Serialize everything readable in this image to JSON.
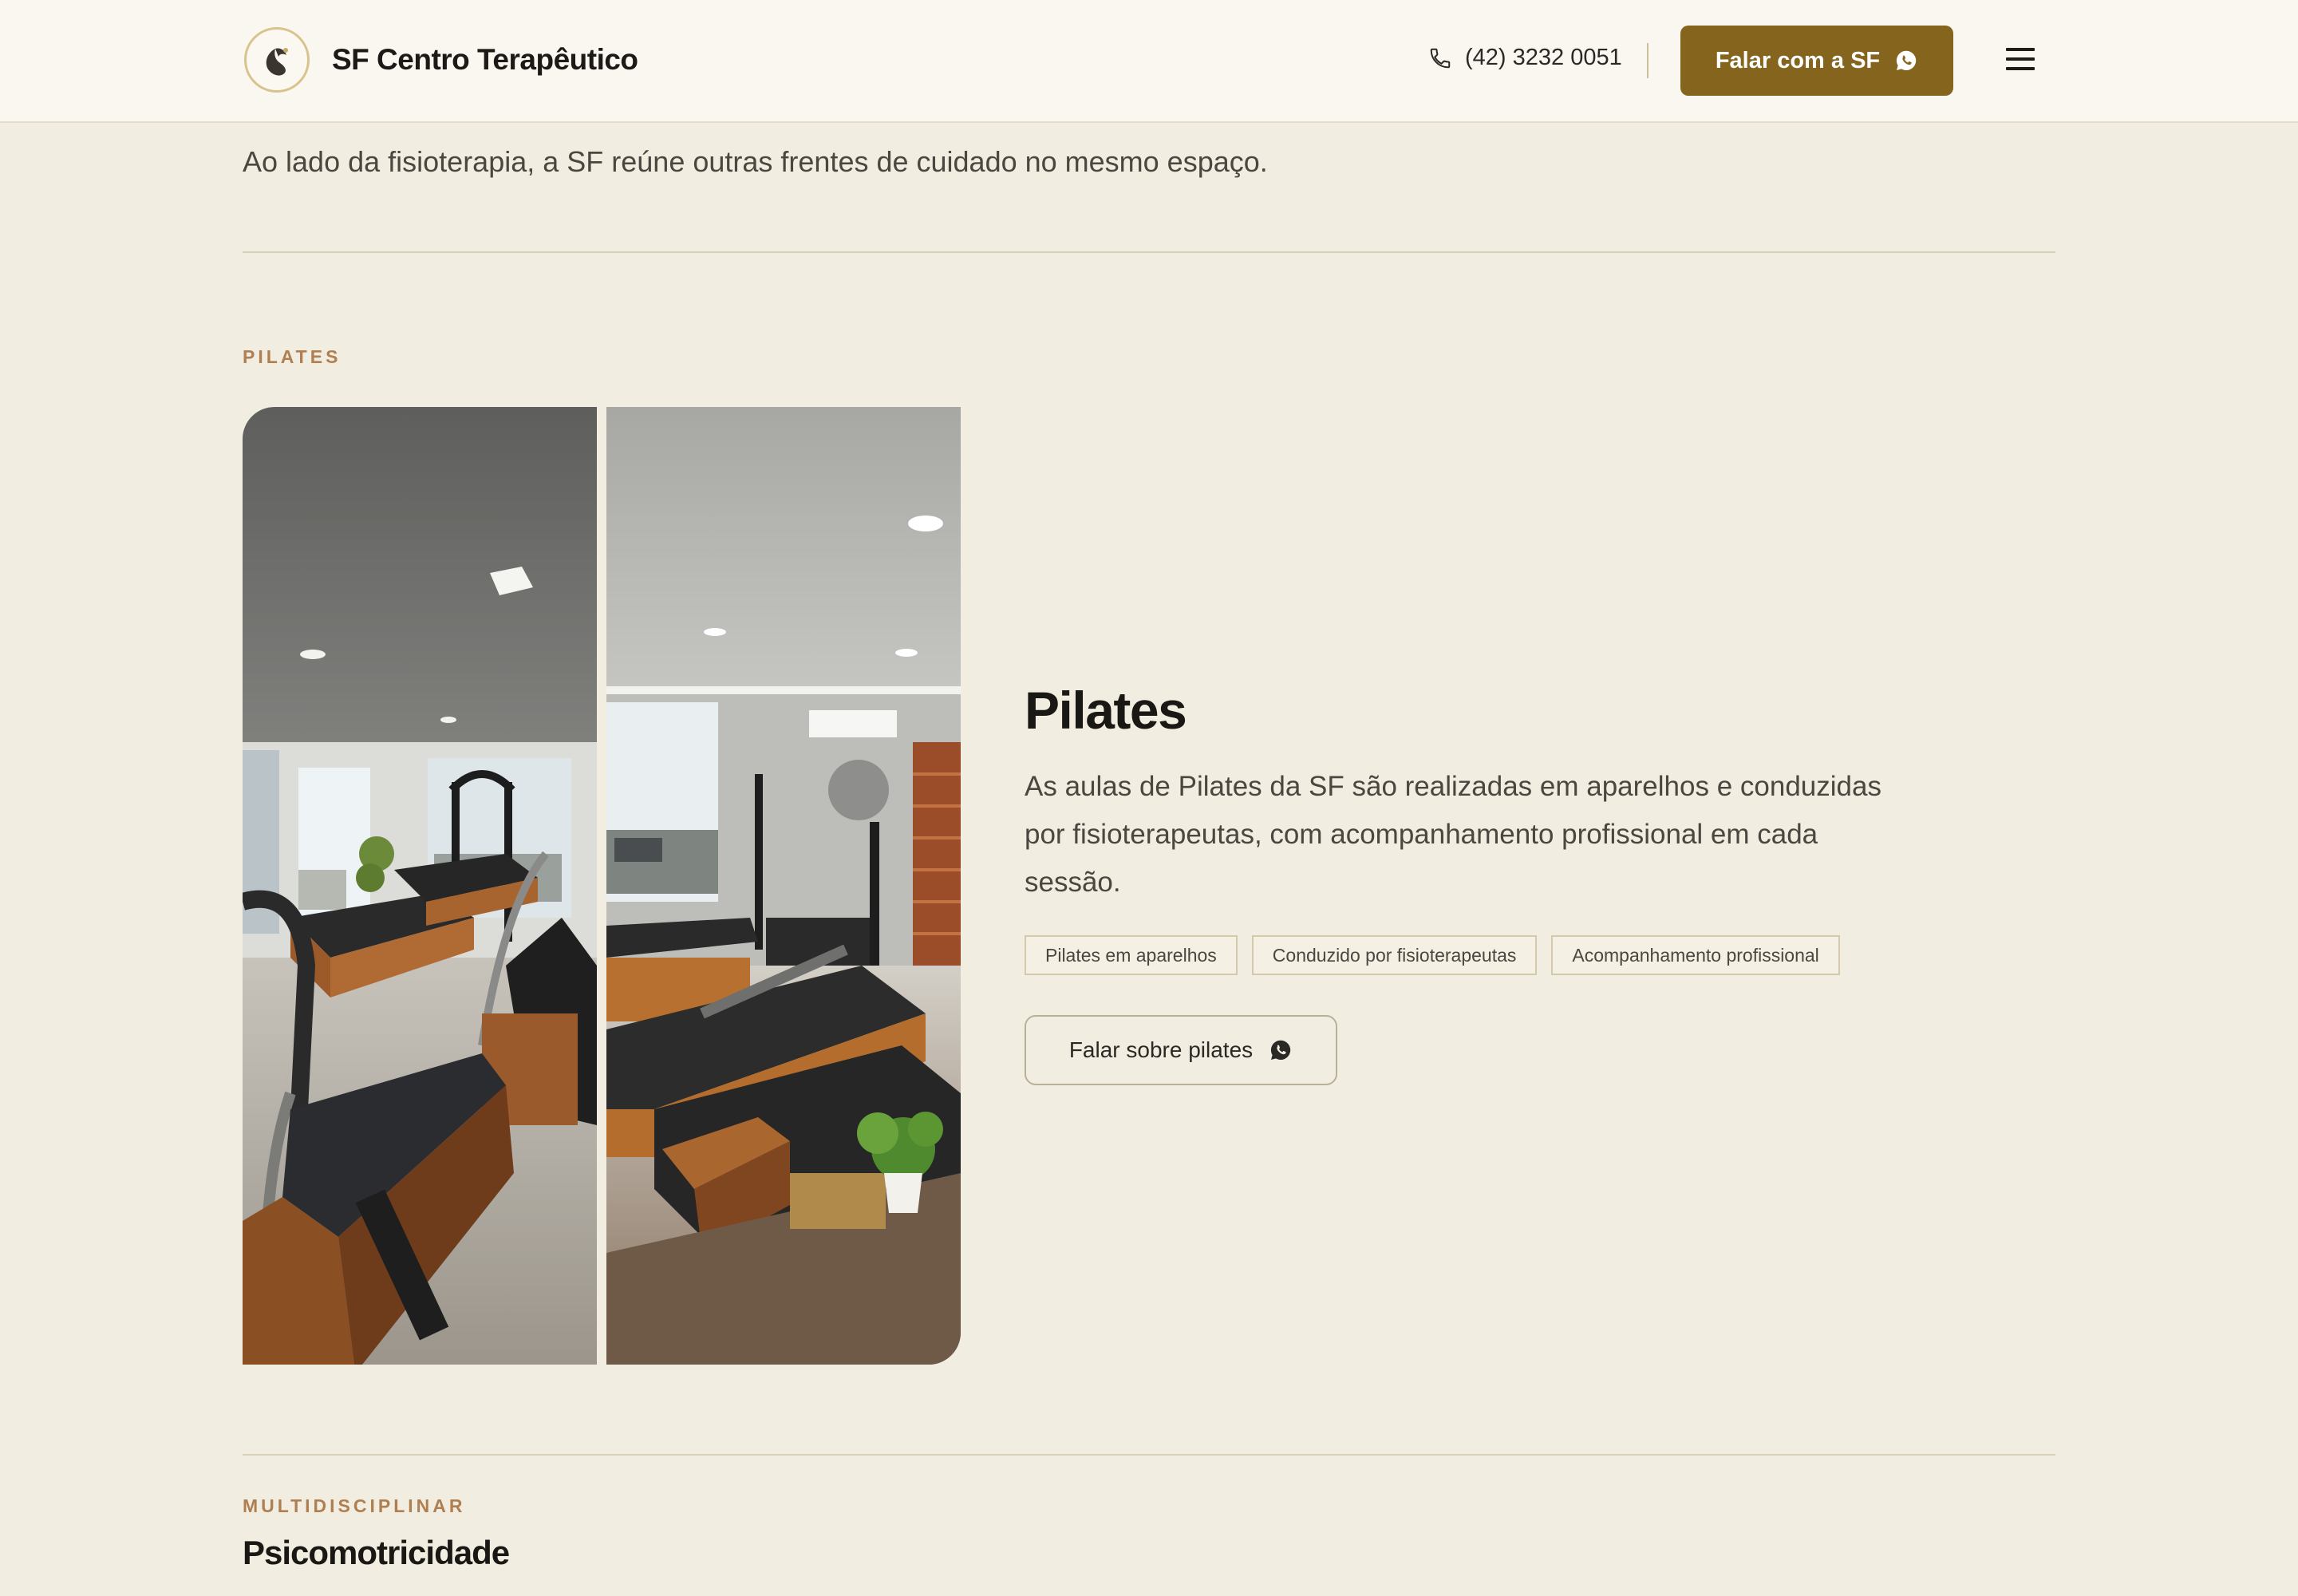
{
  "header": {
    "brand_name": "SF Centro Terapêutico",
    "logo_icon": "leaf-swirl-icon",
    "phone": "(42) 3232 0051",
    "cta_label": "Falar com a SF",
    "cta_icon": "whatsapp-icon",
    "menu_icon": "hamburger-menu-icon",
    "cta_color": "#85641e"
  },
  "intro": {
    "text": "Ao lado da fisioterapia, a SF reúne outras frentes de cuidado no mesmo espaço."
  },
  "pilates": {
    "eyebrow": "PILATES",
    "title": "Pilates",
    "description": "As aulas de Pilates da SF são realizadas em aparelhos e conduzidas por fisioterapeutas, com acompanhamento profissional em cada sessão.",
    "tags": [
      "Pilates em aparelhos",
      "Conduzido por fisioterapeutas",
      "Acompanhamento profissional"
    ],
    "button_label": "Falar sobre pilates",
    "button_icon": "whatsapp-icon"
  },
  "next_section": {
    "eyebrow": "MULTIDISCIPLINAR",
    "title": "Psicomotricidade"
  },
  "colors": {
    "background": "#f2ede1",
    "accent": "#85641e",
    "eyebrow": "#b07f51"
  }
}
